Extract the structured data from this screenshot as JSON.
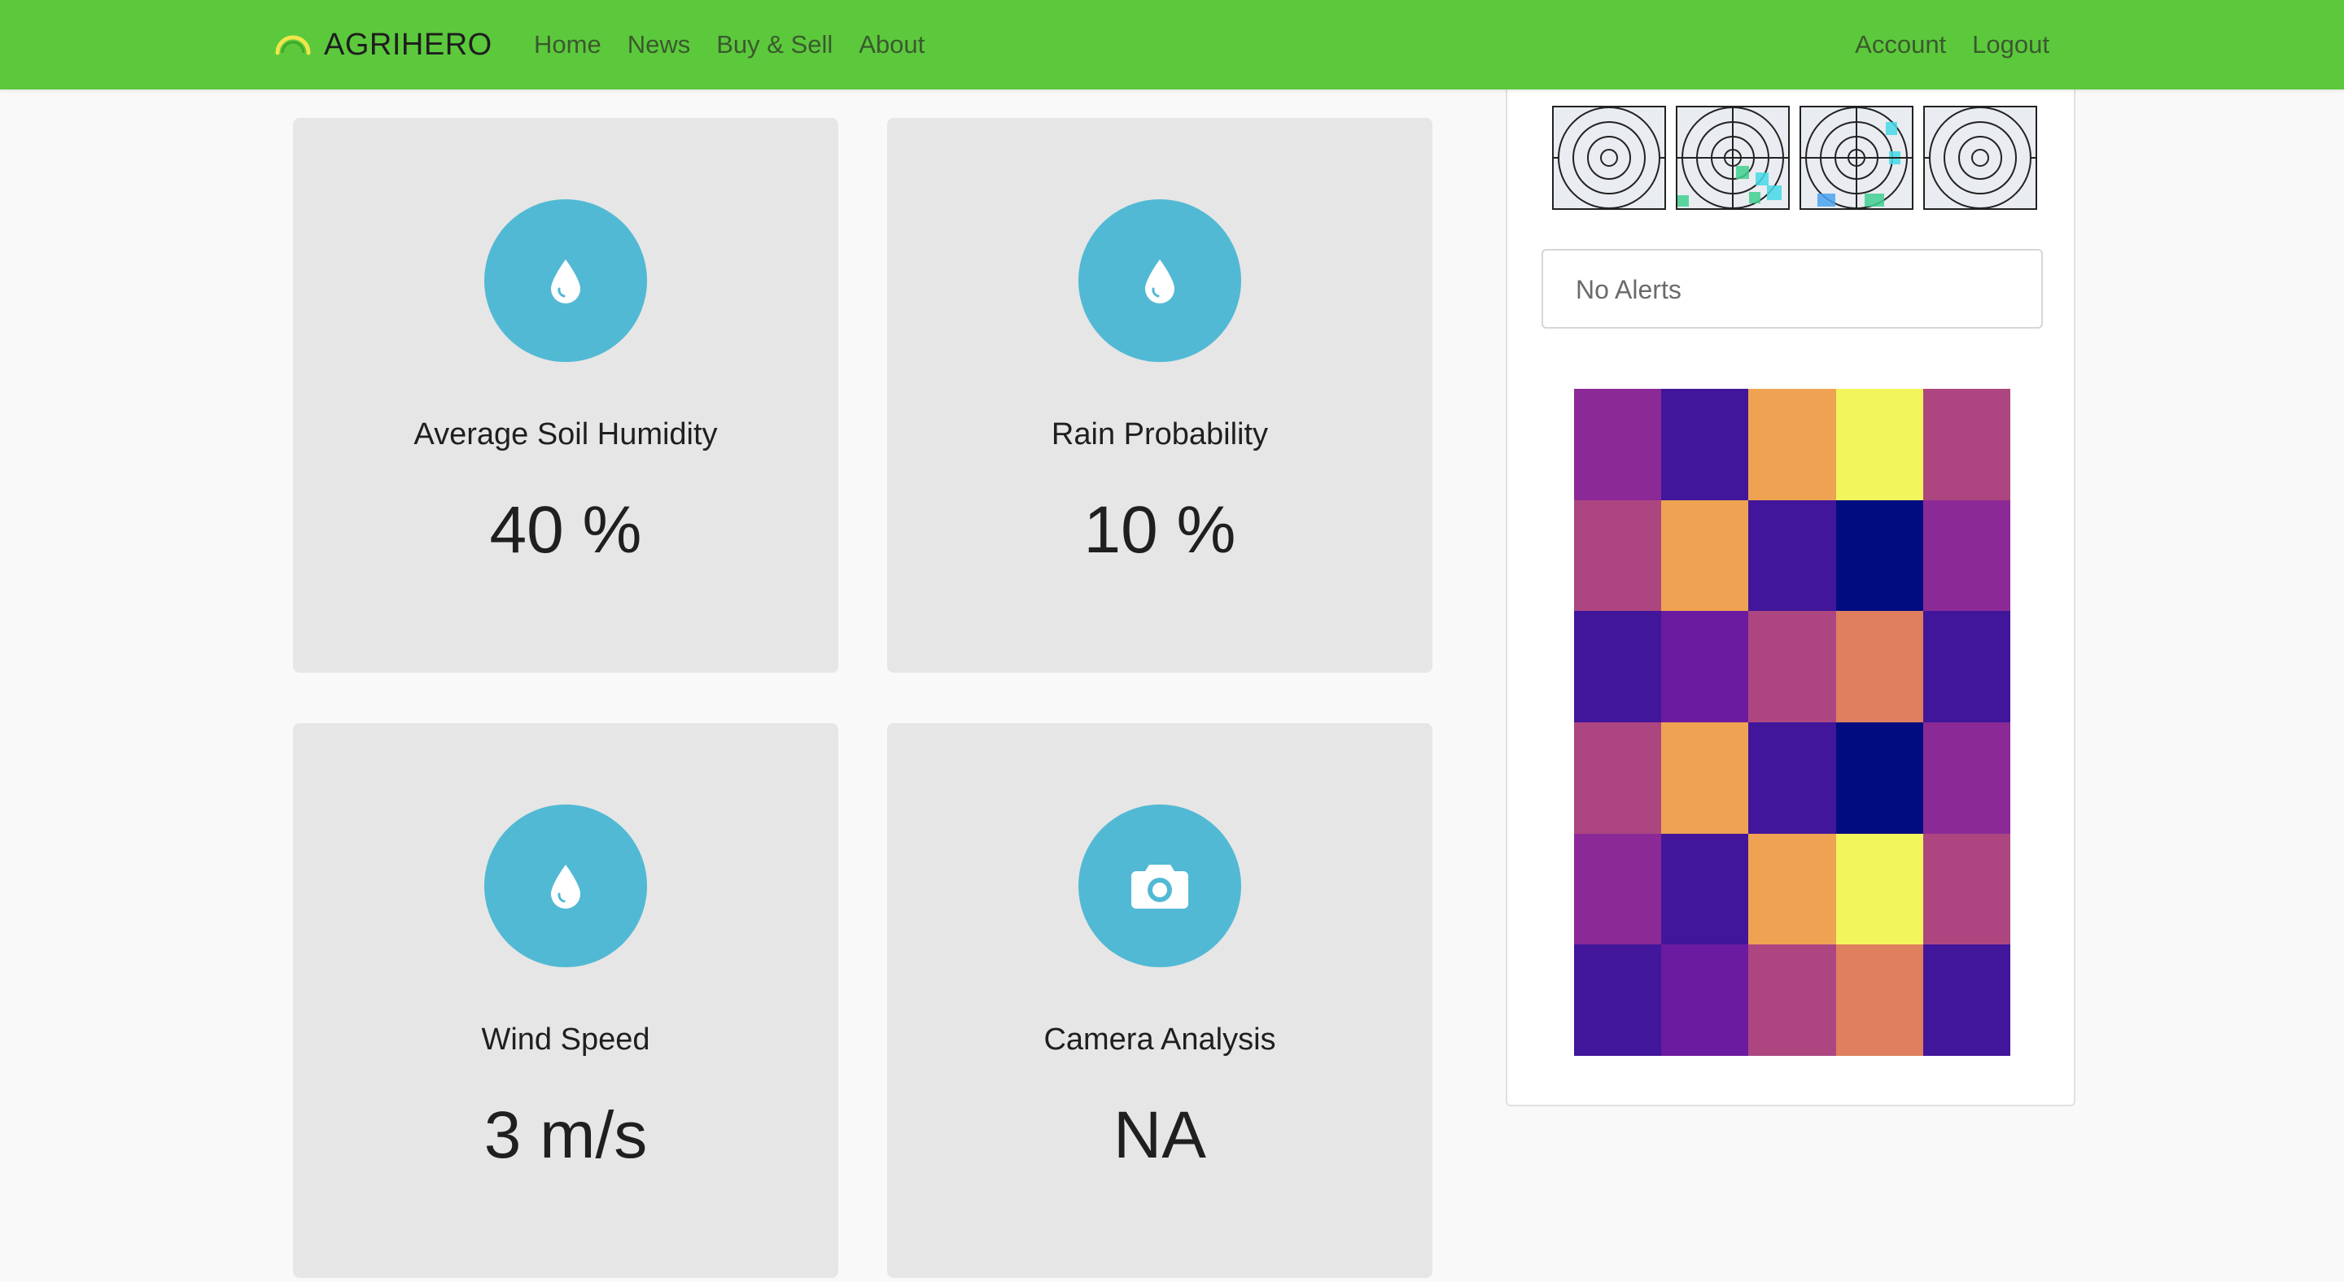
{
  "navbar": {
    "brand": "AGRIHERO",
    "brand_icon": "sun-arc-logo",
    "links_left": [
      "Home",
      "News",
      "Buy & Sell",
      "About"
    ],
    "links_right": [
      "Account",
      "Logout"
    ],
    "colors": {
      "background": "#5cc93c",
      "link": "#3a5a2e"
    }
  },
  "cards": [
    {
      "title": "Average Soil Humidity",
      "value": "40 %",
      "icon": "water-drop-icon"
    },
    {
      "title": "Rain Probability",
      "value": "10 %",
      "icon": "water-drop-icon"
    },
    {
      "title": "Wind Speed",
      "value": "3 m/s",
      "icon": "water-drop-icon"
    },
    {
      "title": "Camera Analysis",
      "value": "NA",
      "icon": "camera-icon"
    }
  ],
  "accent_color": "#52b9d4",
  "side_panel": {
    "thumbnails": [
      {
        "icon": "target-radar-icon"
      },
      {
        "icon": "target-radar-icon"
      },
      {
        "icon": "target-radar-icon"
      },
      {
        "icon": "target-radar-icon"
      }
    ],
    "alerts_text": "No Alerts",
    "heatmap": {
      "rows": 6,
      "cols": 5,
      "colors": [
        [
          "#8b2a96",
          "#41169a",
          "#efa352",
          "#f2f55c",
          "#ad4680"
        ],
        [
          "#ad4680",
          "#efa352",
          "#41169a",
          "#000c7f",
          "#8b2a96"
        ],
        [
          "#41169a",
          "#6b1ba0",
          "#ad4680",
          "#e07f5e",
          "#41169a"
        ],
        [
          "#ad4680",
          "#efa352",
          "#41169a",
          "#000c7f",
          "#8b2a96"
        ],
        [
          "#8b2a96",
          "#41169a",
          "#efa352",
          "#f2f55c",
          "#ad4680"
        ],
        [
          "#41169a",
          "#6b1ba0",
          "#ad4680",
          "#e07f5e",
          "#41169a"
        ]
      ]
    }
  }
}
